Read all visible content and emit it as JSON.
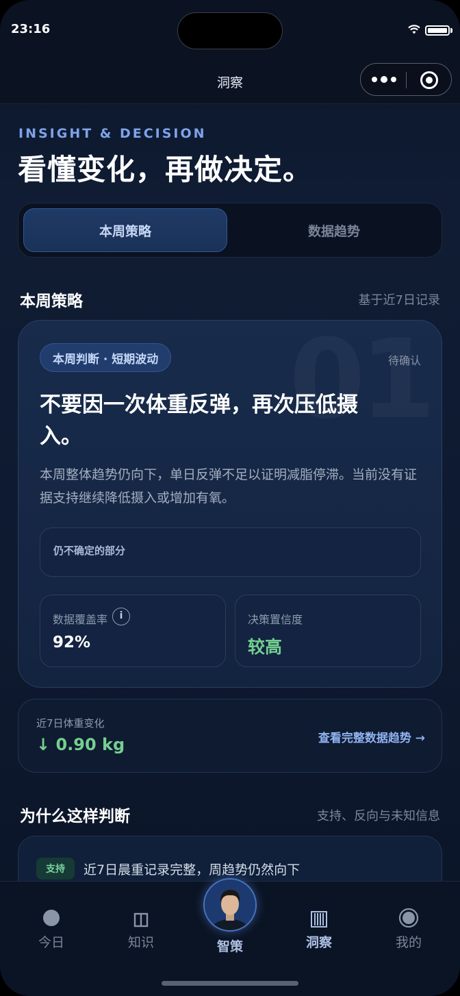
{
  "status": {
    "time": "23:16"
  },
  "nav": {
    "title": "洞察"
  },
  "header": {
    "eyebrow": "INSIGHT & DECISION",
    "headline": "看懂变化，再做决定。"
  },
  "segments": {
    "active": "本周策略",
    "inactive": "数据趋势"
  },
  "section1": {
    "title": "本周策略",
    "meta": "基于近7日记录"
  },
  "strategy": {
    "watermark": "01",
    "chip": "本周判断 · 短期波动",
    "status": "待确认",
    "verdict": "不要因一次体重反弹，再次压低摄入。",
    "description": "本周整体趋势仍向下，单日反弹不足以证明减脂停滞。当前没有证据支持继续降低摄入或增加有氧。",
    "uncertain_label": "仍不确定的部分",
    "coverage_label": "数据覆盖率",
    "coverage_value": "92%",
    "confidence_label": "决策置信度",
    "confidence_value": "较高"
  },
  "weight": {
    "label": "近7日体重变化",
    "value": "↓ 0.90 kg",
    "link": "查看完整数据趋势 →"
  },
  "section2": {
    "title": "为什么这样判断",
    "meta": "支持、反向与未知信息"
  },
  "reason": {
    "badge": "支持",
    "text": "近7日晨重记录完整，周趋势仍然向下"
  },
  "tabs": [
    "今日",
    "知识",
    "智策",
    "洞察",
    "我的"
  ],
  "colors": {
    "accent": "#8fb2f0",
    "positive": "#74d08f",
    "background": "#0e1a30"
  }
}
